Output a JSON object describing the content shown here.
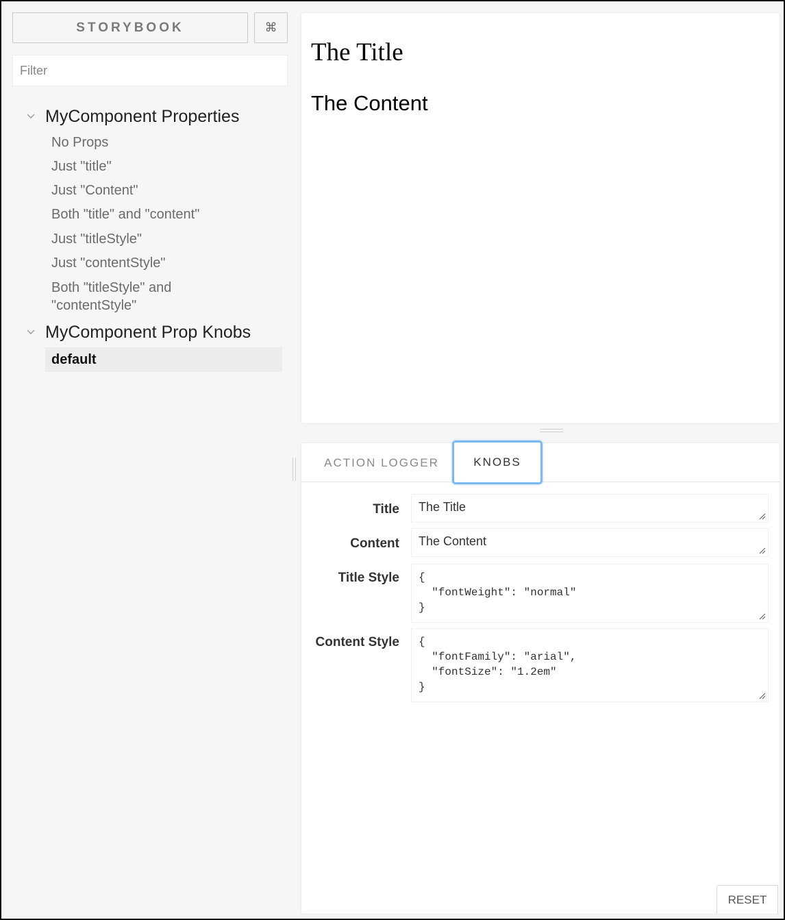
{
  "sidebar": {
    "brand": "STORYBOOK",
    "shortcut_icon": "⌘",
    "filter_placeholder": "Filter",
    "kinds": [
      {
        "label": "MyComponent Properties",
        "stories": [
          "No Props",
          "Just \"title\"",
          "Just \"Content\"",
          "Both \"title\" and \"content\"",
          "Just \"titleStyle\"",
          "Just \"contentStyle\"",
          "Both \"titleStyle\" and \"contentStyle\""
        ]
      },
      {
        "label": "MyComponent Prop Knobs",
        "stories": [
          "default"
        ]
      }
    ],
    "selected_story": "default"
  },
  "preview": {
    "title": "The Title",
    "content": "The Content"
  },
  "addons": {
    "tabs": [
      "ACTION LOGGER",
      "KNOBS"
    ],
    "active_tab": "KNOBS",
    "knobs": [
      {
        "label": "Title",
        "value": "The Title"
      },
      {
        "label": "Content",
        "value": "The Content"
      },
      {
        "label": "Title Style",
        "value": "{\n  \"fontWeight\": \"normal\"\n}"
      },
      {
        "label": "Content Style",
        "value": "{\n  \"fontFamily\": \"arial\",\n  \"fontSize\": \"1.2em\"\n}"
      }
    ],
    "reset_label": "RESET"
  },
  "icons": {
    "expand": "chevron-down-icon",
    "shortcut": "command-icon",
    "resize_grip": "resize-grip-icon"
  }
}
